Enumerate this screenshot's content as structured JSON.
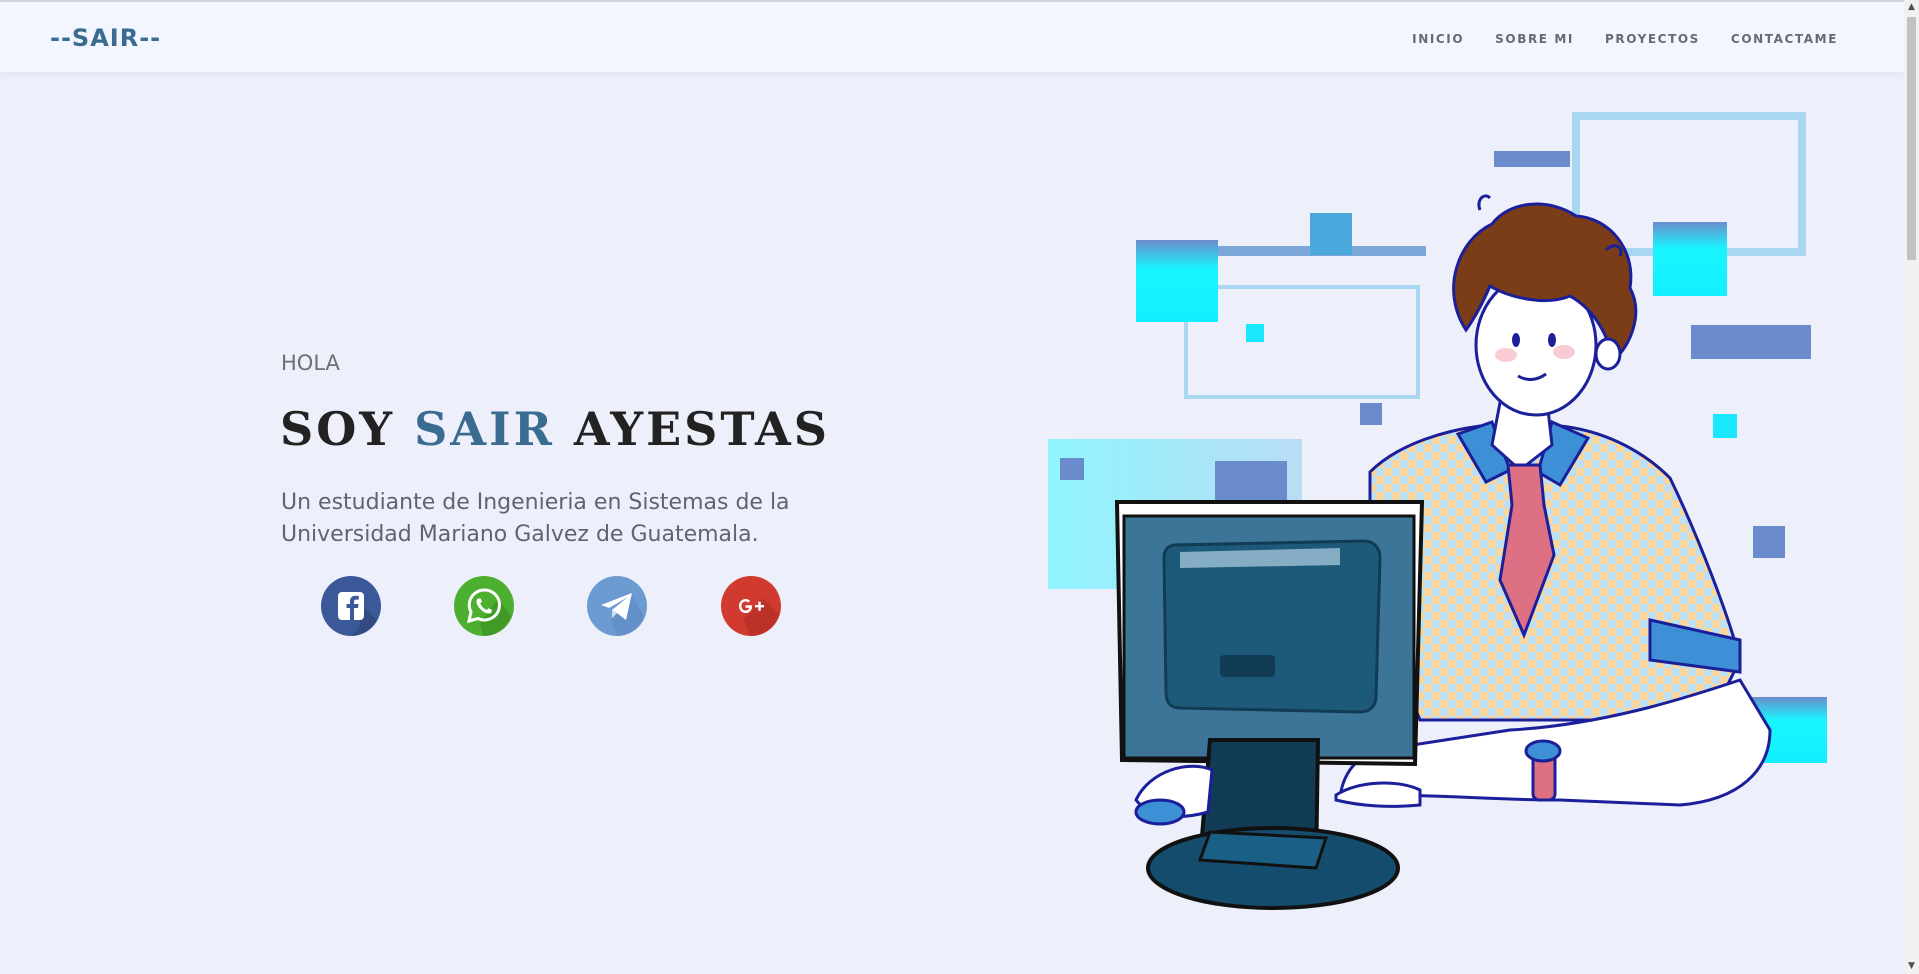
{
  "brand": {
    "logo_text": "--SAIR--"
  },
  "nav": {
    "items": [
      "INICIO",
      "SOBRE MI",
      "PROYECTOS",
      "CONTACTAME"
    ]
  },
  "hero": {
    "greeting": "HOLA",
    "headline_pre": "SOY",
    "headline_name": "SAIR",
    "headline_post": "AYESTAS",
    "description": "Un estudiante de Ingenieria en Sistemas de la Universidad Mariano Galvez de Guatemala."
  },
  "social": [
    {
      "icon": "facebook-icon",
      "color": "#3b5998"
    },
    {
      "icon": "whatsapp-icon",
      "color": "#4caf2f"
    },
    {
      "icon": "telegram-icon",
      "color": "#6c9bd2"
    },
    {
      "icon": "google-plus-icon",
      "color": "#d13b2f"
    }
  ],
  "colors": {
    "accent": "#3a6b91",
    "background": "#edf0fb",
    "navbar": "#f3f6ff"
  }
}
